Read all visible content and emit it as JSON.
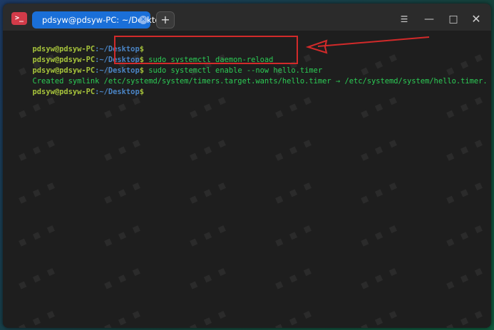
{
  "window": {
    "tab_title": "pdsyw@pdsyw-PC: ~/Desktop",
    "new_tab_label": "+",
    "menu_icon_glyph": "☰",
    "min_glyph": "—",
    "max_glyph": "□",
    "close_glyph": "✕"
  },
  "terminal": {
    "lines": [
      {
        "user": "pdsyw@pdsyw-PC",
        "path": ":~/Desktop",
        "sep": "$",
        "cmd": ""
      },
      {
        "user": "pdsyw@pdsyw-PC",
        "path": ":~/Desktop",
        "sep": "$",
        "cmd": " sudo systemctl daemon-reload"
      },
      {
        "user": "pdsyw@pdsyw-PC",
        "path": ":~/Desktop",
        "sep": "$",
        "cmd": " sudo systemctl enable --now hello.timer"
      },
      {
        "output": "Created symlink /etc/systemd/system/timers.target.wants/hello.timer → /etc/systemd/system/hello.timer."
      },
      {
        "user": "pdsyw@pdsyw-PC",
        "path": ":~/Desktop",
        "sep": "$",
        "cmd": ""
      }
    ]
  },
  "colors": {
    "prompt_user": "#a6c33b",
    "prompt_path": "#4a84c4",
    "command": "#2ccc55",
    "annotation": "#d22a2a",
    "tab_active": "#1a6fd8"
  }
}
